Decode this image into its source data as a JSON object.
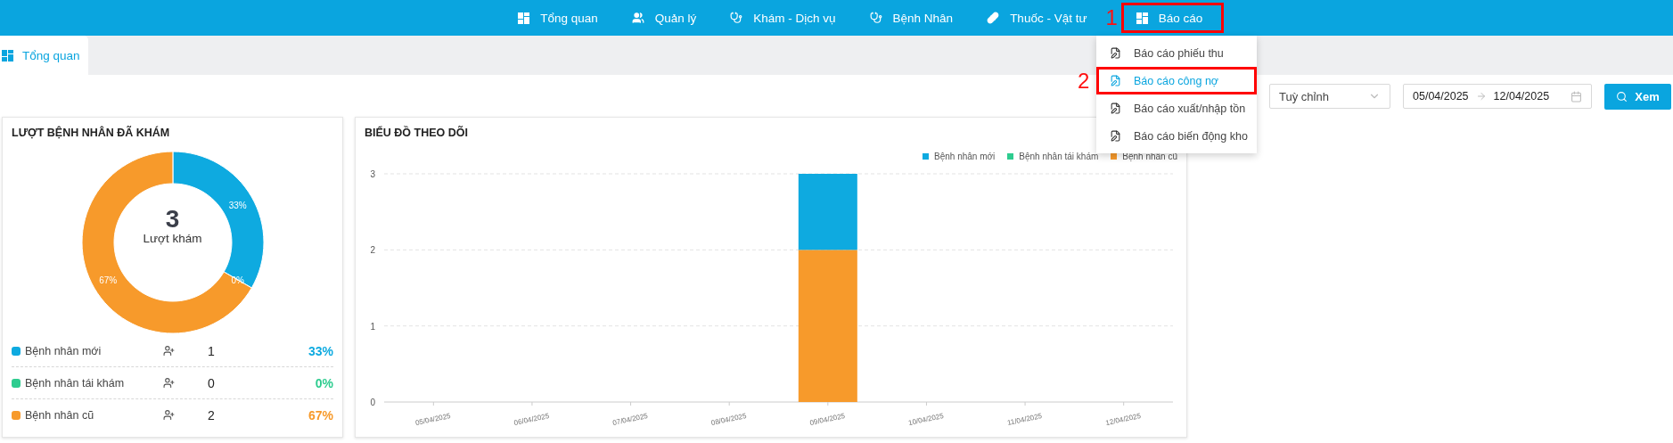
{
  "nav": {
    "items": [
      {
        "label": "Tổng quan",
        "highlighted": false
      },
      {
        "label": "Quản lý",
        "highlighted": false
      },
      {
        "label": "Khám - Dịch vụ",
        "highlighted": false
      },
      {
        "label": "Bệnh Nhân",
        "highlighted": false
      },
      {
        "label": "Thuốc - Vật tư",
        "highlighted": false
      },
      {
        "label": "Báo cáo",
        "highlighted": true,
        "annotation": "1"
      }
    ]
  },
  "menu": {
    "items": [
      {
        "label": "Báo cáo phiếu thu",
        "selected": false,
        "highlighted": false
      },
      {
        "label": "Báo cáo công nợ",
        "selected": true,
        "highlighted": true,
        "annotation": "2"
      },
      {
        "label": "Báo cáo xuất/nhập tồn",
        "selected": false,
        "highlighted": false
      },
      {
        "label": "Báo cáo biến động kho",
        "selected": false,
        "highlighted": false
      }
    ]
  },
  "tabs": [
    {
      "label": "Tổng quan",
      "selected": true
    }
  ],
  "filter": {
    "period": "Tuỳ chỉnh",
    "date_from": "05/04/2025",
    "date_to": "12/04/2025",
    "button": "Xem"
  },
  "visits_card": {
    "title": "LƯỢT BỆNH NHÂN ĐÃ KHÁM",
    "total": "3",
    "total_label": "Lượt khám",
    "segments": [
      {
        "name": "Bệnh nhân mới",
        "count": "1",
        "percent": "33%",
        "ring_label": "33%",
        "color": "#0eaae0"
      },
      {
        "name": "Bệnh nhân tái khám",
        "count": "0",
        "percent": "0%",
        "ring_label": "0%",
        "color": "#2ecc8f"
      },
      {
        "name": "Bệnh nhân cũ",
        "count": "2",
        "percent": "67%",
        "ring_label": "67%",
        "color": "#f79a2b"
      }
    ]
  },
  "chart_card": {
    "title": "BIỂU ĐỒ THEO DÕI",
    "chart_data": {
      "type": "bar",
      "stacked": true,
      "categories": [
        "05/04/2025",
        "06/04/2025",
        "07/04/2025",
        "08/04/2025",
        "09/04/2025",
        "10/04/2025",
        "11/04/2025",
        "12/04/2025"
      ],
      "series": [
        {
          "name": "Bệnh nhân mới",
          "color": "#0eaae0",
          "values": [
            0,
            0,
            0,
            0,
            1,
            0,
            0,
            0
          ]
        },
        {
          "name": "Bệnh nhân tái khám",
          "color": "#2ecc8f",
          "values": [
            0,
            0,
            0,
            0,
            0,
            0,
            0,
            0
          ]
        },
        {
          "name": "Bệnh nhân cũ",
          "color": "#f79a2b",
          "values": [
            0,
            0,
            0,
            0,
            2,
            0,
            0,
            0
          ]
        }
      ],
      "ylim": [
        0,
        3
      ],
      "yticks": [
        0,
        1,
        2,
        3
      ]
    }
  }
}
